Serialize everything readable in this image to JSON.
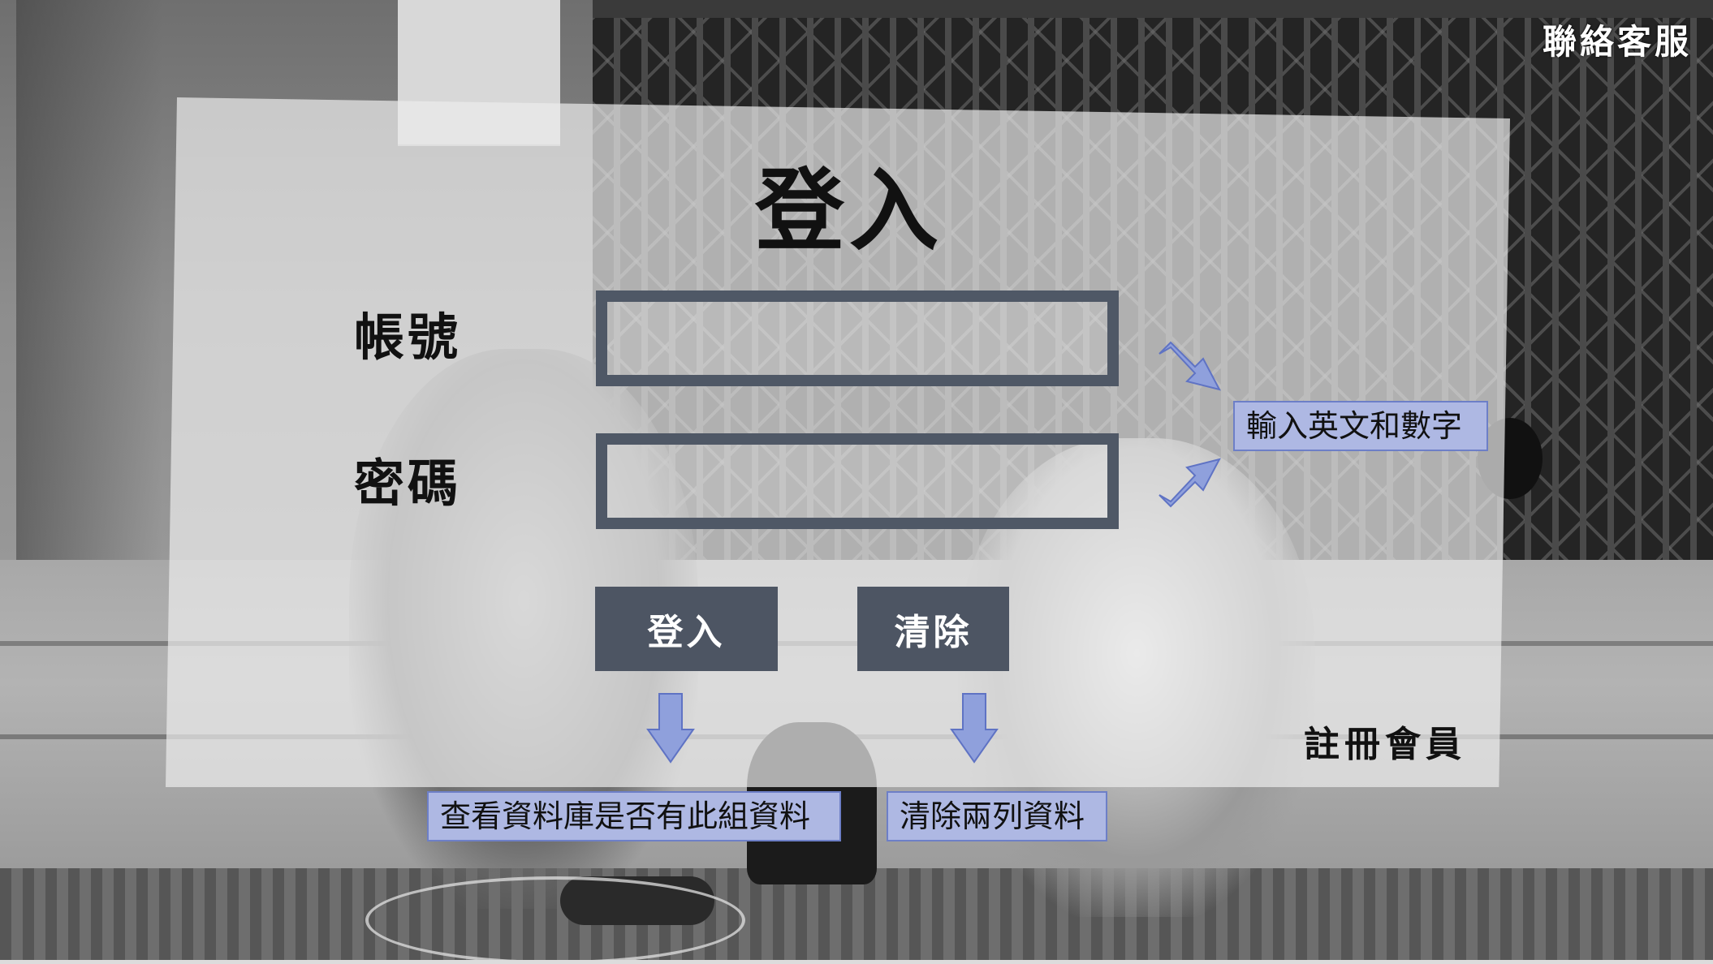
{
  "contact": {
    "label": "聯絡客服"
  },
  "login_form": {
    "title": "登入",
    "account_label": "帳號",
    "password_label": "密碼",
    "account_value": "",
    "password_value": "",
    "login_button_label": "登入",
    "clear_button_label": "清除",
    "register_label": "註冊會員"
  },
  "annotations": {
    "input_hint": "輸入英文和數字",
    "login_hint": "查看資料庫是否有此組資料",
    "clear_hint": "清除兩列資料"
  },
  "colors": {
    "panel": "#ececec",
    "input_border": "#4f5866",
    "button_bg": "#4d5563",
    "note_bg": "#aeb8e3",
    "note_border": "#6d7fc7",
    "arrow_fill": "#8fa0dc"
  },
  "icons": {
    "arrow_down": "arrow-down-icon",
    "arrow_diagonal": "arrow-diagonal-icon"
  }
}
